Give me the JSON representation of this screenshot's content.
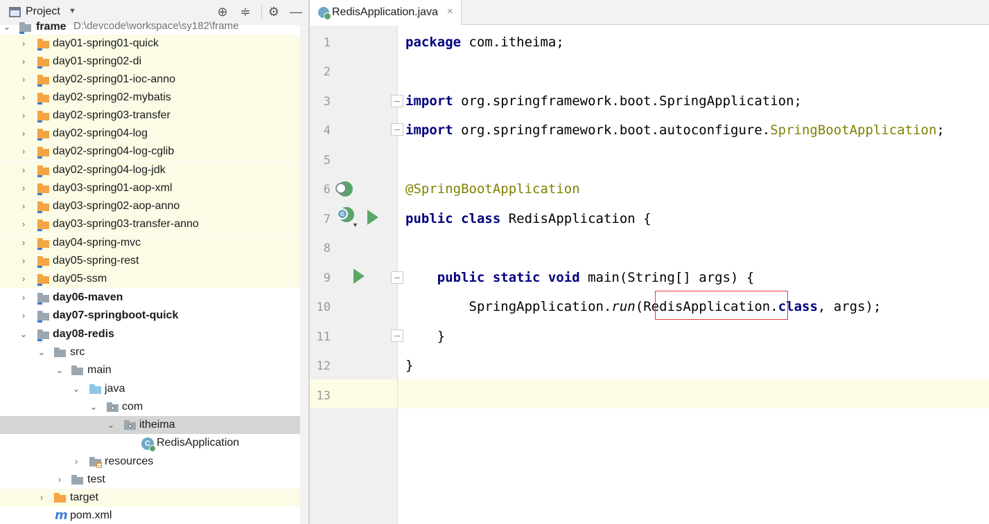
{
  "project_panel": {
    "title": "Project",
    "actions": {
      "locate_icon": "crosshair-icon",
      "collapse_icon": "collapse-all-icon",
      "settings_icon": "gear-icon",
      "hide_icon": "minimize-icon"
    },
    "root": {
      "name": "frame",
      "path": "D:\\devcode\\workspace\\sy182\\frame"
    },
    "modules": [
      "day01-spring01-quick",
      "day01-spring02-di",
      "day02-spring01-ioc-anno",
      "day02-spring02-mybatis",
      "day02-spring03-transfer",
      "day02-spring04-log",
      "day02-spring04-log-cglib",
      "day02-spring04-log-jdk",
      "day03-spring01-aop-xml",
      "day03-spring02-aop-anno",
      "day03-spring03-transfer-anno",
      "day04-spring-mvc",
      "day05-spring-rest",
      "day05-ssm"
    ],
    "bold_modules": [
      "day06-maven",
      "day07-springboot-quick",
      "day08-redis"
    ],
    "tree": {
      "src": "src",
      "main": "main",
      "java": "java",
      "com": "com",
      "itheima": "itheima",
      "class_file": "RedisApplication",
      "resources": "resources",
      "test": "test",
      "target": "target",
      "pom": "pom.xml"
    },
    "colors": {
      "excluded_bg": "#fbfbe6",
      "selected_bg": "#d5d5d5"
    }
  },
  "editor": {
    "tab": {
      "label": "RedisApplication.java",
      "close": "×"
    },
    "line_numbers": [
      "1",
      "2",
      "3",
      "4",
      "5",
      "6",
      "7",
      "8",
      "9",
      "10",
      "11",
      "12",
      "13"
    ],
    "code": {
      "l1_kw": "package",
      "l1_rest": " com.itheima;",
      "l3_kw": "import",
      "l3_rest": " org.springframework.boot.SpringApplication;",
      "l4_kw": "import",
      "l4_mid": " org.springframework.boot.autoconfigure.",
      "l4_ann": "SpringBootApplication",
      "l4_end": ";",
      "l6_ann": "@SpringBootApplication",
      "l7_kw": "public class",
      "l7_rest": " RedisApplication {",
      "l9_indent": "    ",
      "l9_kw": "public static void",
      "l9_rest": " main(String[] args) {",
      "l10_pre": "        SpringApplication.",
      "l10_method": "run",
      "l10_open": "(",
      "l10_arg": "RedisApplication",
      "l10_dot": ".",
      "l10_kw": "class",
      "l10_end": ", args);",
      "l11": "    }",
      "l12": "}"
    },
    "colors": {
      "keyword": "#000080",
      "annotation": "#808000",
      "current_line": "#fdfce5",
      "highlight_box": "#e53935"
    }
  }
}
